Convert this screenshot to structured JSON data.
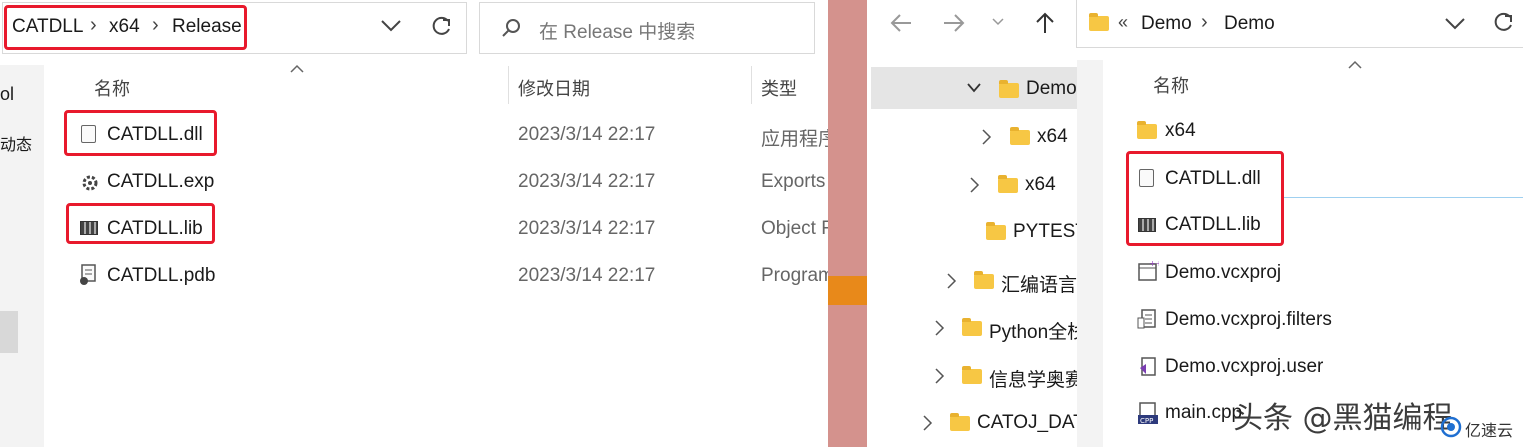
{
  "left": {
    "breadcrumb": {
      "item1": "CATDLL",
      "item2": "x64",
      "item3": "Release",
      "sep": "›"
    },
    "search_placeholder": "在 Release 中搜索",
    "columns": {
      "name": "名称",
      "date": "修改日期",
      "type": "类型"
    },
    "side_fragments": {
      "a": "ol",
      "b": "动态"
    },
    "files": [
      {
        "name": "CATDLL.dll",
        "date": "2023/3/14 22:17",
        "type": "应用程序"
      },
      {
        "name": "CATDLL.exp",
        "date": "2023/3/14 22:17",
        "type": "Exports"
      },
      {
        "name": "CATDLL.lib",
        "date": "2023/3/14 22:17",
        "type": "Object F"
      },
      {
        "name": "CATDLL.pdb",
        "date": "2023/3/14 22:17",
        "type": "Program"
      }
    ]
  },
  "right": {
    "breadcrumb": {
      "prefix": "«",
      "item1": "Demo",
      "item2": "Demo",
      "sep": "›"
    },
    "tree": [
      "Demo",
      "x64",
      "x64",
      "PYTEST",
      "汇编语言",
      "Python全栈",
      "信息学奥赛",
      "CATOJ_DAT"
    ],
    "column_name": "名称",
    "files": [
      "x64",
      "CATDLL.dll",
      "CATDLL.lib",
      "Demo.vcxproj",
      "Demo.vcxproj.filters",
      "Demo.vcxproj.user",
      "main.cpp"
    ]
  },
  "watermark": {
    "text": "头条 @黑猫编程",
    "logo": "亿速云"
  },
  "colors": {
    "highlight": "#e8192c",
    "divider": "#d4928d",
    "accent_orange": "#e8891a"
  }
}
